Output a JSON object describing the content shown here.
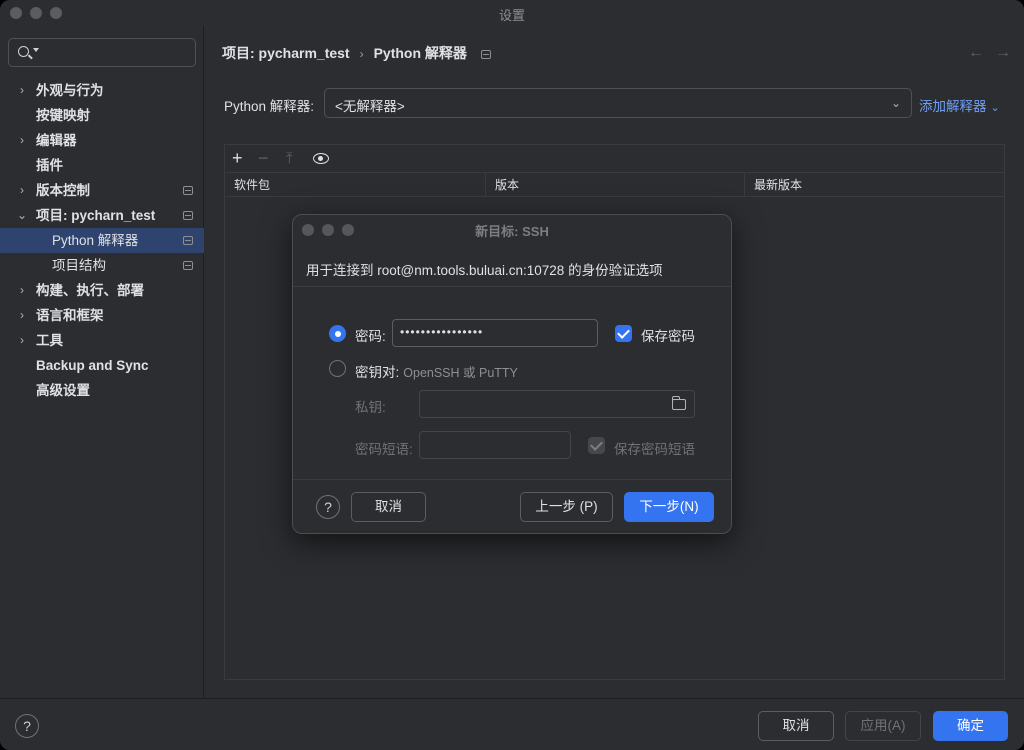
{
  "window": {
    "title": "设置"
  },
  "sidebar": {
    "search_placeholder": "",
    "items": [
      {
        "label": "外观与行为",
        "chevron": "›"
      },
      {
        "label": "按键映射"
      },
      {
        "label": "编辑器",
        "chevron": "›"
      },
      {
        "label": "插件"
      },
      {
        "label": "版本控制",
        "chevron": "›"
      },
      {
        "label": "项目: pycharn_test",
        "chevron": "⌄"
      },
      {
        "label": "Python 解释器"
      },
      {
        "label": "项目结构"
      },
      {
        "label": "构建、执行、部署",
        "chevron": "›"
      },
      {
        "label": "语言和框架",
        "chevron": "›"
      },
      {
        "label": "工具",
        "chevron": "›"
      },
      {
        "label": "Backup and Sync"
      },
      {
        "label": "高级设置"
      }
    ]
  },
  "main": {
    "breadcrumb": {
      "project": "项目: pycharm_test",
      "separator": "›",
      "page": "Python 解释器"
    },
    "nav": {
      "back": "←",
      "forward": "→"
    },
    "interpreter_label": "Python 解释器:",
    "interpreter_value": "<无解释器>",
    "add_interpreter": "添加解释器",
    "toolbar": {
      "add": "+",
      "remove": "−",
      "upgrade": "⤒"
    },
    "columns": [
      "软件包",
      "版本",
      "最新版本"
    ]
  },
  "modal": {
    "title": "新目标: SSH",
    "subtitle": "用于连接到 root@nm.tools.buluai.cn:10728 的身份验证选项",
    "password_label": "密码:",
    "password_value": "••••••••••••••••",
    "save_password": "保存密码",
    "keypair_label": "密钥对:",
    "keypair_hint": "OpenSSH 或 PuTTY",
    "private_key_label": "私钥:",
    "passphrase_label": "密码短语:",
    "save_passphrase": "保存密码短语",
    "help": "?",
    "cancel": "取消",
    "prev": "上一步 (P)",
    "next": "下一步(N)"
  },
  "footer": {
    "help": "?",
    "cancel": "取消",
    "apply": "应用(A)",
    "ok": "确定"
  },
  "colors": {
    "accent": "#3574f0",
    "link": "#6f9ff5",
    "selected": "#2e436e"
  },
  "icons": [
    "search-icon",
    "chevron-right-icon",
    "chevron-down-icon",
    "eye-icon",
    "folder-icon",
    "help-icon"
  ]
}
